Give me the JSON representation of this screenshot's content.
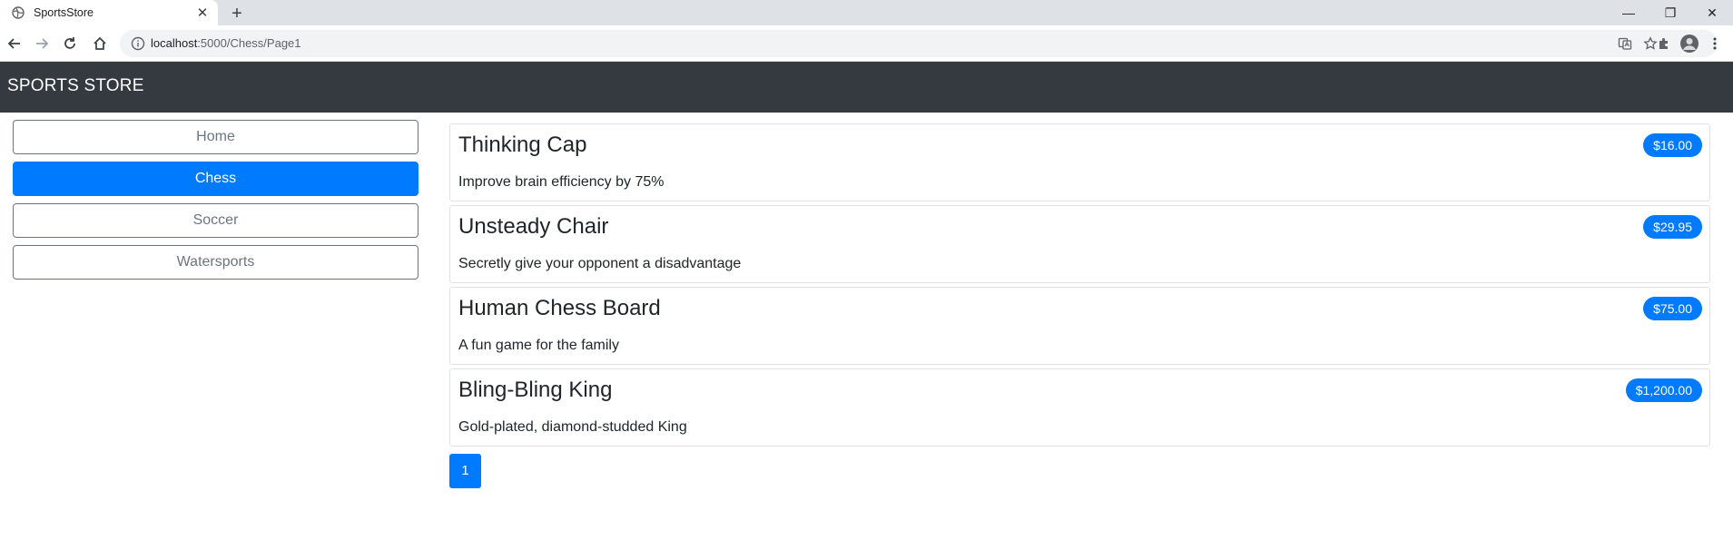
{
  "browser": {
    "tab_title": "SportsStore",
    "tab_close_symbol": "✕",
    "new_tab_symbol": "+",
    "url_host": "localhost",
    "url_path": ":5000/Chess/Page1",
    "window": {
      "minimize": "—",
      "restore": "❐",
      "close": "✕"
    }
  },
  "navbar": {
    "brand": "SPORTS STORE"
  },
  "sidebar": {
    "items": [
      {
        "label": "Home",
        "active": false
      },
      {
        "label": "Chess",
        "active": true
      },
      {
        "label": "Soccer",
        "active": false
      },
      {
        "label": "Watersports",
        "active": false
      }
    ]
  },
  "products": [
    {
      "name": "Thinking Cap",
      "description": "Improve brain efficiency by 75%",
      "price": "$16.00"
    },
    {
      "name": "Unsteady Chair",
      "description": "Secretly give your opponent a disadvantage",
      "price": "$29.95"
    },
    {
      "name": "Human Chess Board",
      "description": "A fun game for the family",
      "price": "$75.00"
    },
    {
      "name": "Bling-Bling King",
      "description": "Gold-plated, diamond-studded King",
      "price": "$1,200.00"
    }
  ],
  "pagination": {
    "pages": [
      "1"
    ],
    "current": "1"
  },
  "colors": {
    "navbar": "#343a40",
    "primary": "#007bff",
    "secondary": "#6c757d"
  }
}
